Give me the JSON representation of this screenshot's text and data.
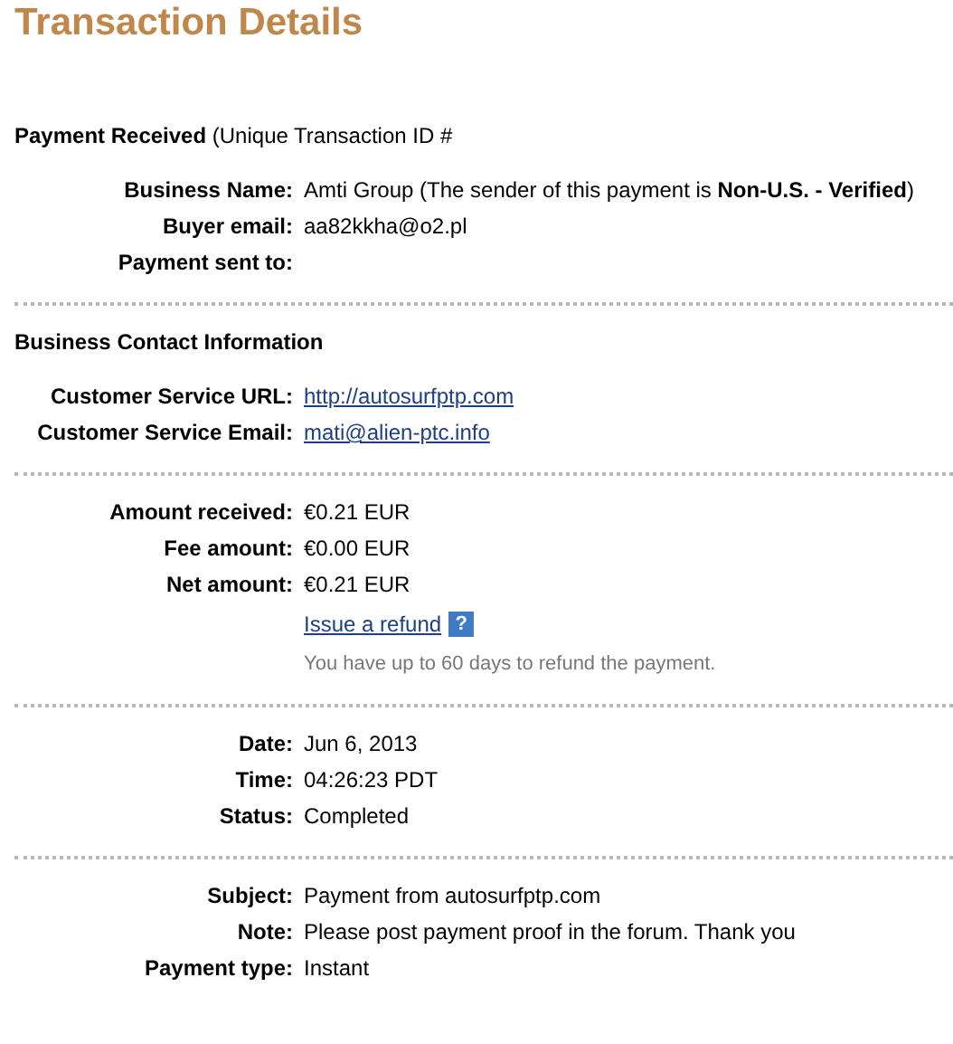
{
  "title": "Transaction Details",
  "sections": [
    {
      "heading": "**Payment Received** (Unique Transaction ID #",
      "rows": [
        {
          "label": "Business Name:",
          "value": "Amti Group (The sender of this payment is **Non-U.S. - Verified**)",
          "kind": "text"
        },
        {
          "label": "Buyer email:",
          "value": "aa82kkha@o2.pl",
          "kind": "text"
        },
        {
          "label": "Payment sent to:",
          "kind": "text"
        }
      ]
    },
    {
      "heading": "**Business Contact Information**",
      "rows": [
        {
          "label": "Customer Service URL:",
          "value": "http://autosurfptp.com",
          "kind": "link"
        },
        {
          "label": "Customer Service Email:",
          "value": "mati@alien-ptc.info",
          "kind": "link"
        }
      ]
    },
    {
      "rows": [
        {
          "label": "Amount received:",
          "value": "€0.21 EUR",
          "kind": "text"
        },
        {
          "label": "Fee amount:",
          "value": "€0.00 EUR",
          "kind": "text"
        },
        {
          "label": "Net amount:",
          "value": "€0.21 EUR",
          "kind": "text"
        },
        {
          "value": "Issue a refund",
          "help": "?",
          "note": "You have up to 60 days to refund the payment.",
          "kind": "refund"
        }
      ]
    },
    {
      "rows": [
        {
          "label": "Date:",
          "value": "Jun 6, 2013",
          "kind": "text"
        },
        {
          "label": "Time:",
          "value": "04:26:23 PDT",
          "kind": "text"
        },
        {
          "label": "Status:",
          "value": "Completed",
          "kind": "text"
        }
      ]
    },
    {
      "rows": [
        {
          "label": "Subject:",
          "value": "Payment from autosurfptp.com",
          "kind": "text"
        },
        {
          "label": "Note:",
          "value": "Please post payment proof in the forum. Thank you",
          "kind": "text"
        },
        {
          "label": "Payment type:",
          "value": "Instant",
          "kind": "text"
        }
      ]
    }
  ]
}
